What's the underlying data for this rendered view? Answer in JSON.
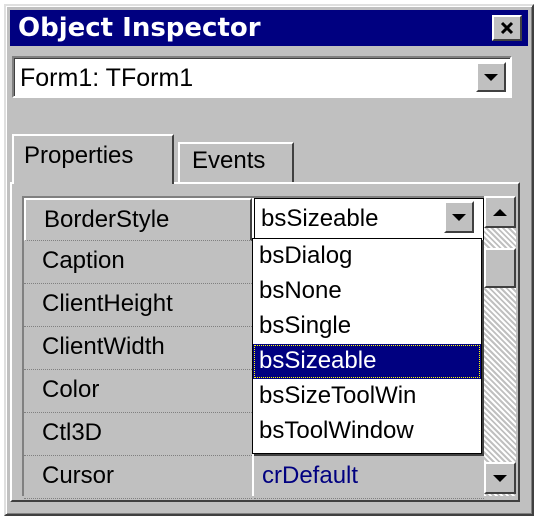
{
  "window": {
    "title": "Object Inspector"
  },
  "component_selector": {
    "value": "Form1: TForm1"
  },
  "tabs": [
    {
      "label": "Properties",
      "active": true
    },
    {
      "label": "Events",
      "active": false
    }
  ],
  "properties": [
    {
      "name": "BorderStyle",
      "value": "bsSizeable",
      "selected": true
    },
    {
      "name": "Caption",
      "value": ""
    },
    {
      "name": "ClientHeight",
      "value": ""
    },
    {
      "name": "ClientWidth",
      "value": ""
    },
    {
      "name": "Color",
      "value": ""
    },
    {
      "name": "Ctl3D",
      "value": ""
    },
    {
      "name": "Cursor",
      "value": "crDefault"
    }
  ],
  "border_style_dropdown": {
    "options": [
      "bsDialog",
      "bsNone",
      "bsSingle",
      "bsSizeable",
      "bsSizeToolWin",
      "bsToolWindow"
    ],
    "highlighted": "bsSizeable"
  },
  "colors": {
    "title_bar": "#000080",
    "selection": "#000080",
    "value_text": "#000080",
    "face": "#c0c0c0"
  }
}
